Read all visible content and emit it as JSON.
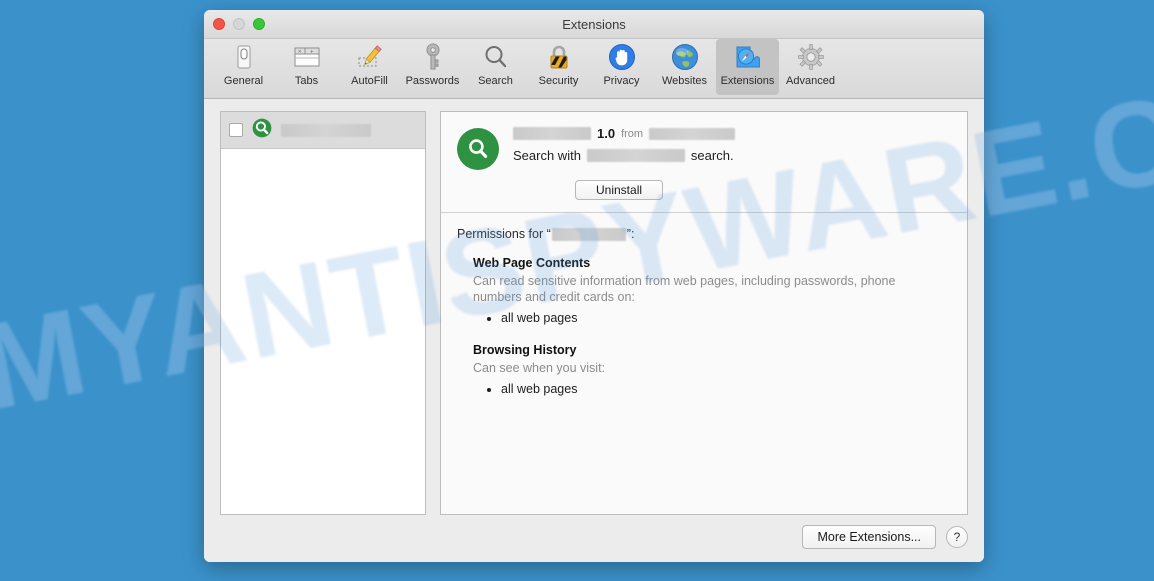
{
  "desktop": {
    "watermark": "MYANTISPYWARE.COM",
    "background_color": "#3b92cb"
  },
  "window": {
    "title": "Extensions",
    "traffic_lights": [
      {
        "name": "close",
        "color": "#f55549"
      },
      {
        "name": "minimize",
        "color": "#d6d6d6"
      },
      {
        "name": "zoom",
        "color": "#3ac63a"
      }
    ]
  },
  "toolbar": {
    "items": [
      {
        "label": "General",
        "icon": "general-icon",
        "selected": false
      },
      {
        "label": "Tabs",
        "icon": "tabs-icon",
        "selected": false
      },
      {
        "label": "AutoFill",
        "icon": "autofill-icon",
        "selected": false
      },
      {
        "label": "Passwords",
        "icon": "key-icon",
        "selected": false
      },
      {
        "label": "Search",
        "icon": "magnifier-icon",
        "selected": false
      },
      {
        "label": "Security",
        "icon": "lock-icon",
        "selected": false
      },
      {
        "label": "Privacy",
        "icon": "hand-icon",
        "selected": false
      },
      {
        "label": "Websites",
        "icon": "globe-icon",
        "selected": false
      },
      {
        "label": "Extensions",
        "icon": "puzzle-icon",
        "selected": true
      },
      {
        "label": "Advanced",
        "icon": "gear-icon",
        "selected": false
      }
    ]
  },
  "sidebar": {
    "rows": [
      {
        "checked": false,
        "icon": "green-magnifier-icon",
        "name_redacted": true,
        "name_width": 90
      }
    ]
  },
  "detail": {
    "icon": "green-magnifier-icon",
    "name_redacted": true,
    "name_width": 78,
    "version": "1.0",
    "from_label": "from",
    "publisher_redacted": true,
    "publisher_width": 86,
    "description_prefix": "Search with",
    "description_redacted": true,
    "description_width": 98,
    "description_suffix": "search.",
    "uninstall_label": "Uninstall",
    "permissions_prefix": "Permissions for “",
    "permissions_name_redacted": true,
    "permissions_name_width": 74,
    "permissions_suffix": "”:",
    "permission_groups": [
      {
        "title": "Web Page Contents",
        "description": "Can read sensitive information from web pages, including passwords, phone numbers and credit cards on:",
        "items": [
          "all web pages"
        ]
      },
      {
        "title": "Browsing History",
        "description": "Can see when you visit:",
        "items": [
          "all web pages"
        ]
      }
    ]
  },
  "footer": {
    "more_extensions_label": "More Extensions...",
    "help_label": "?"
  },
  "colors": {
    "extension_green": "#2f9243",
    "selected_tab": "#c3c3c3"
  }
}
